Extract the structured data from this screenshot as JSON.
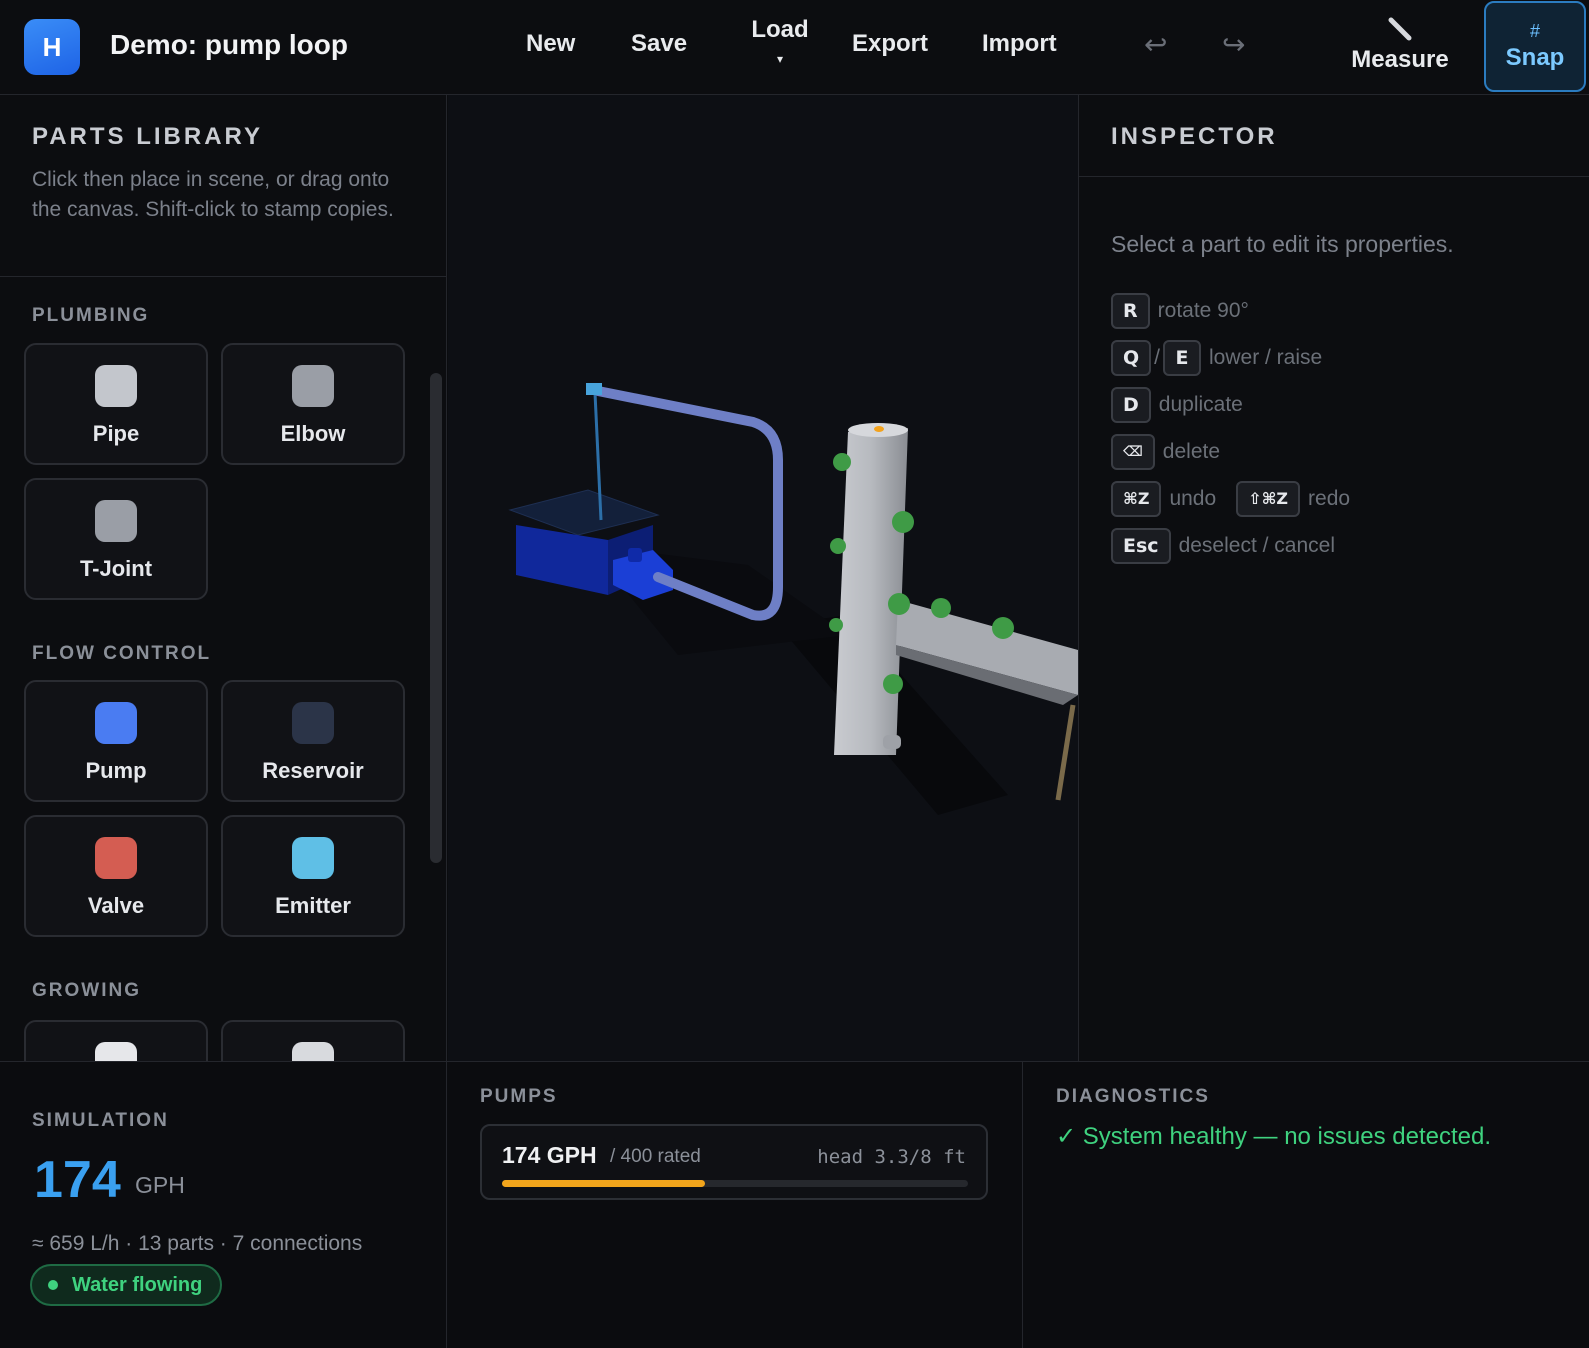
{
  "app": {
    "logo_letter": "H",
    "title": "Demo: pump loop"
  },
  "toolbar": {
    "new": "New",
    "save": "Save",
    "load": "Load",
    "load_caret": "▾",
    "export": "Export",
    "import": "Import",
    "undo_icon": "↩",
    "redo_icon": "↪",
    "measure_icon": "ruler-icon",
    "measure": "Measure",
    "snap_icon": "#",
    "snap": "Snap"
  },
  "library": {
    "title": "PARTS LIBRARY",
    "description": "Click then place in scene, or drag onto the canvas. Shift-click to stamp copies.",
    "sections": [
      {
        "title": "PLUMBING",
        "items": [
          {
            "label": "Pipe",
            "color": "#c3c6cc"
          },
          {
            "label": "Elbow",
            "color": "#9a9ea6"
          },
          {
            "label": "T-Joint",
            "color": "#9a9ea6"
          }
        ]
      },
      {
        "title": "FLOW CONTROL",
        "items": [
          {
            "label": "Pump",
            "color": "#4a7cf2"
          },
          {
            "label": "Reservoir",
            "color": "#2b3448"
          },
          {
            "label": "Valve",
            "color": "#d45d52"
          },
          {
            "label": "Emitter",
            "color": "#5fbfe6"
          }
        ]
      },
      {
        "title": "GROWING",
        "items": [
          {
            "label": "",
            "color": "#e6e7ea"
          },
          {
            "label": "",
            "color": "#d8dade"
          }
        ]
      }
    ]
  },
  "inspector": {
    "title": "INSPECTOR",
    "hint": "Select a part to edit its properties.",
    "shortcuts": [
      {
        "keys": [
          "R"
        ],
        "action": "rotate 90°"
      },
      {
        "keys": [
          "Q",
          "E"
        ],
        "separator": "/",
        "action": "lower / raise"
      },
      {
        "keys": [
          "D"
        ],
        "action": "duplicate"
      },
      {
        "keys": [
          "⌫"
        ],
        "action": "delete"
      },
      {
        "keys": [
          "⌘Z"
        ],
        "action": "undo",
        "keys2": [
          "⇧⌘Z"
        ],
        "action2": "redo"
      },
      {
        "keys": [
          "Esc"
        ],
        "action": "deselect / cancel"
      }
    ]
  },
  "simulation": {
    "title": "SIMULATION",
    "flow_value": "174",
    "flow_unit": "GPH",
    "summary": "≈ 659 L/h · 13 parts · 7 connections",
    "status": "Water flowing",
    "status_color": "#3fd27f"
  },
  "pumps": {
    "title": "PUMPS",
    "items": [
      {
        "flow": "174 GPH",
        "rated": "/ 400 rated",
        "head": "head 3.3/8 ft",
        "load_fraction": 0.435,
        "bar_color": "#f2a51c"
      }
    ]
  },
  "diagnostics": {
    "title": "DIAGNOSTICS",
    "message": "✓ System healthy — no issues detected.",
    "color": "#3fd27f"
  },
  "colors": {
    "accent": "#3aa0f0",
    "snap_active": "#7ccaff"
  }
}
